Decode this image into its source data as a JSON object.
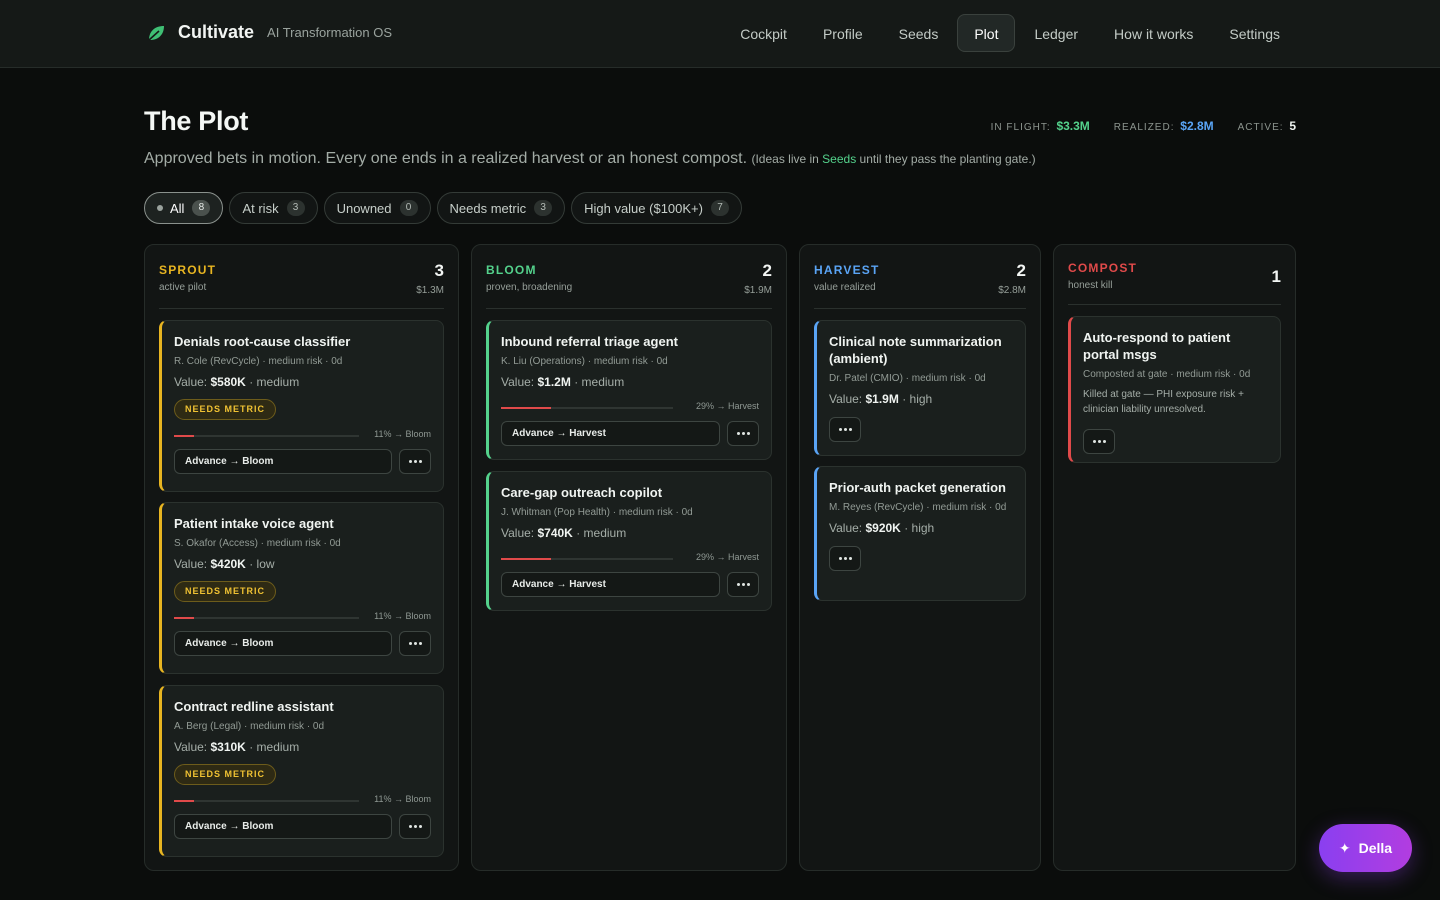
{
  "app": {
    "name": "Cultivate",
    "tagline": "AI Transformation OS"
  },
  "nav": [
    {
      "label": "Cockpit",
      "active": false
    },
    {
      "label": "Profile",
      "active": false
    },
    {
      "label": "Seeds",
      "active": false
    },
    {
      "label": "Plot",
      "active": true
    },
    {
      "label": "Ledger",
      "active": false
    },
    {
      "label": "How it works",
      "active": false
    },
    {
      "label": "Settings",
      "active": false
    }
  ],
  "header": {
    "title": "The Plot",
    "subtitle": "Approved bets in motion. Every one ends in a realized harvest or an honest compost.",
    "note_before": "(Ideas live in ",
    "note_link": "Seeds",
    "note_after": " until they pass the planting gate.)",
    "stats": [
      {
        "label": "IN FLIGHT:",
        "value": "$3.3M"
      },
      {
        "label": "REALIZED:",
        "value": "$2.8M"
      },
      {
        "label": "ACTIVE:",
        "value": "5"
      }
    ]
  },
  "filters": [
    {
      "label": "All",
      "count": "8"
    },
    {
      "label": "At risk",
      "count": "3"
    },
    {
      "label": "Unowned",
      "count": "0"
    },
    {
      "label": "Needs metric",
      "count": "3"
    },
    {
      "label": "High value ($100K+)",
      "count": "7"
    }
  ],
  "colors": {
    "sprout": "#e8b521",
    "bloom": "#54d28c",
    "harvest": "#5aa4f5",
    "compost": "#e04a4a",
    "accent": "#9b3ff0"
  },
  "columns": [
    {
      "name": "SPROUT",
      "desc": "active pilot",
      "count": "3",
      "value": "$1.3M",
      "cards": [
        {
          "title": "Denials root-cause classifier",
          "meta": "R. Cole (RevCycle) · medium risk · 0d",
          "value_label": "Value:",
          "value": "$580K",
          "value_tail": "· medium",
          "badge": "NEEDS METRIC",
          "progress": 11,
          "progress_label": "11% → Bloom",
          "action": "Advance → Bloom"
        },
        {
          "title": "Patient intake voice agent",
          "meta": "S. Okafor (Access) · medium risk · 0d",
          "value_label": "Value:",
          "value": "$420K",
          "value_tail": "· low",
          "badge": "NEEDS METRIC",
          "progress": 11,
          "progress_label": "11% → Bloom",
          "action": "Advance → Bloom"
        },
        {
          "title": "Contract redline assistant",
          "meta": "A. Berg (Legal) · medium risk · 0d",
          "value_label": "Value:",
          "value": "$310K",
          "value_tail": "· medium",
          "badge": "NEEDS METRIC",
          "progress": 11,
          "progress_label": "11% → Bloom",
          "action": "Advance → Bloom"
        }
      ]
    },
    {
      "name": "BLOOM",
      "desc": "proven, broadening",
      "count": "2",
      "value": "$1.9M",
      "cards": [
        {
          "title": "Inbound referral triage agent",
          "meta": "K. Liu (Operations) · medium risk · 0d",
          "value_label": "Value:",
          "value": "$1.2M",
          "value_tail": "· medium",
          "progress": 29,
          "progress_label": "29% → Harvest",
          "action": "Advance → Harvest"
        },
        {
          "title": "Care-gap outreach copilot",
          "meta": "J. Whitman (Pop Health) · medium risk · 0d",
          "value_label": "Value:",
          "value": "$740K",
          "value_tail": "· medium",
          "progress": 29,
          "progress_label": "29% → Harvest",
          "action": "Advance → Harvest"
        }
      ]
    },
    {
      "name": "HARVEST",
      "desc": "value realized",
      "count": "2",
      "value": "$2.8M",
      "cards": [
        {
          "title": "Clinical note summarization (ambient)",
          "meta": "Dr. Patel (CMIO) · medium risk · 0d",
          "value_label": "Value:",
          "value": "$1.9M",
          "value_tail": "· high"
        },
        {
          "title": "Prior-auth packet generation",
          "meta": "M. Reyes (RevCycle) · medium risk · 0d",
          "value_label": "Value:",
          "value": "$920K",
          "value_tail": "· high"
        }
      ]
    },
    {
      "name": "COMPOST",
      "desc": "honest kill",
      "count": "1",
      "value": "",
      "cards": [
        {
          "title": "Auto-respond to patient portal msgs",
          "meta": "Composted at gate · medium risk · 0d",
          "note": "Killed at gate — PHI exposure risk + clinician liability unresolved."
        }
      ]
    }
  ],
  "assistant": {
    "label": "Della",
    "icon": "sparkle-icon"
  }
}
